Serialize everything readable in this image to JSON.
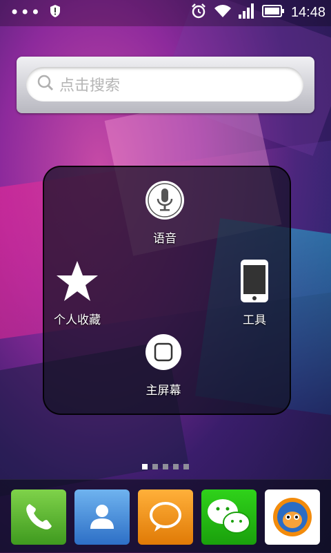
{
  "status_bar": {
    "time": "14:48",
    "left_icons": [
      "more-dots-icon",
      "shield-icon"
    ],
    "right_icons": [
      "alarm-icon",
      "wifi-icon",
      "signal-icon",
      "battery-icon"
    ]
  },
  "search": {
    "placeholder": "点击搜索"
  },
  "assistive_menu": {
    "items": [
      {
        "label": "语音",
        "icon": "microphone-icon"
      },
      {
        "label": "个人收藏",
        "icon": "star-icon"
      },
      {
        "label": "工具",
        "icon": "phone-device-icon"
      },
      {
        "label": "主屏幕",
        "icon": "home-button-icon"
      }
    ]
  },
  "pager": {
    "pages": 5,
    "active": 1
  },
  "dock": {
    "apps": [
      {
        "icon": "phone-app-icon",
        "color": "#5cb531"
      },
      {
        "icon": "contacts-app-icon",
        "color": "#3b82d6"
      },
      {
        "icon": "messages-app-icon",
        "color": "#f08a12"
      },
      {
        "icon": "wechat-app-icon",
        "color": "#39c52b"
      },
      {
        "icon": "uc-browser-app-icon",
        "color": "#ffffff"
      }
    ]
  }
}
